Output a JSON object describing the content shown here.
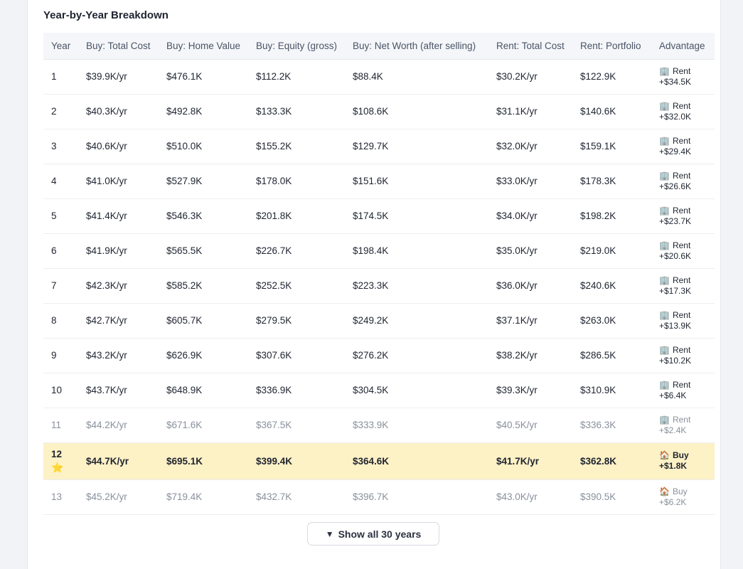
{
  "section": {
    "title": "Year-by-Year Breakdown"
  },
  "table": {
    "headers": [
      "Year",
      "Buy: Total Cost",
      "Buy: Home Value",
      "Buy: Equity (gross)",
      "Buy: Net Worth (after selling)",
      "Rent: Total Cost",
      "Rent: Portfolio",
      "Advantage"
    ],
    "rows": [
      {
        "year": "1",
        "total_cost": "$39.9K/yr",
        "home_value": "$476.1K",
        "equity": "$112.2K",
        "net_worth": "$88.4K",
        "rent_cost": "$30.2K/yr",
        "portfolio": "$122.9K",
        "adv_label": "Rent",
        "adv_amount": "+$34.5K",
        "adv_icon": "office-building-icon",
        "state": "normal"
      },
      {
        "year": "2",
        "total_cost": "$40.3K/yr",
        "home_value": "$492.8K",
        "equity": "$133.3K",
        "net_worth": "$108.6K",
        "rent_cost": "$31.1K/yr",
        "portfolio": "$140.6K",
        "adv_label": "Rent",
        "adv_amount": "+$32.0K",
        "adv_icon": "office-building-icon",
        "state": "normal"
      },
      {
        "year": "3",
        "total_cost": "$40.6K/yr",
        "home_value": "$510.0K",
        "equity": "$155.2K",
        "net_worth": "$129.7K",
        "rent_cost": "$32.0K/yr",
        "portfolio": "$159.1K",
        "adv_label": "Rent",
        "adv_amount": "+$29.4K",
        "adv_icon": "office-building-icon",
        "state": "normal"
      },
      {
        "year": "4",
        "total_cost": "$41.0K/yr",
        "home_value": "$527.9K",
        "equity": "$178.0K",
        "net_worth": "$151.6K",
        "rent_cost": "$33.0K/yr",
        "portfolio": "$178.3K",
        "adv_label": "Rent",
        "adv_amount": "+$26.6K",
        "adv_icon": "office-building-icon",
        "state": "normal"
      },
      {
        "year": "5",
        "total_cost": "$41.4K/yr",
        "home_value": "$546.3K",
        "equity": "$201.8K",
        "net_worth": "$174.5K",
        "rent_cost": "$34.0K/yr",
        "portfolio": "$198.2K",
        "adv_label": "Rent",
        "adv_amount": "+$23.7K",
        "adv_icon": "office-building-icon",
        "state": "normal"
      },
      {
        "year": "6",
        "total_cost": "$41.9K/yr",
        "home_value": "$565.5K",
        "equity": "$226.7K",
        "net_worth": "$198.4K",
        "rent_cost": "$35.0K/yr",
        "portfolio": "$219.0K",
        "adv_label": "Rent",
        "adv_amount": "+$20.6K",
        "adv_icon": "office-building-icon",
        "state": "normal"
      },
      {
        "year": "7",
        "total_cost": "$42.3K/yr",
        "home_value": "$585.2K",
        "equity": "$252.5K",
        "net_worth": "$223.3K",
        "rent_cost": "$36.0K/yr",
        "portfolio": "$240.6K",
        "adv_label": "Rent",
        "adv_amount": "+$17.3K",
        "adv_icon": "office-building-icon",
        "state": "normal"
      },
      {
        "year": "8",
        "total_cost": "$42.7K/yr",
        "home_value": "$605.7K",
        "equity": "$279.5K",
        "net_worth": "$249.2K",
        "rent_cost": "$37.1K/yr",
        "portfolio": "$263.0K",
        "adv_label": "Rent",
        "adv_amount": "+$13.9K",
        "adv_icon": "office-building-icon",
        "state": "normal"
      },
      {
        "year": "9",
        "total_cost": "$43.2K/yr",
        "home_value": "$626.9K",
        "equity": "$307.6K",
        "net_worth": "$276.2K",
        "rent_cost": "$38.2K/yr",
        "portfolio": "$286.5K",
        "adv_label": "Rent",
        "adv_amount": "+$10.2K",
        "adv_icon": "office-building-icon",
        "state": "normal"
      },
      {
        "year": "10",
        "total_cost": "$43.7K/yr",
        "home_value": "$648.9K",
        "equity": "$336.9K",
        "net_worth": "$304.5K",
        "rent_cost": "$39.3K/yr",
        "portfolio": "$310.9K",
        "adv_label": "Rent",
        "adv_amount": "+$6.4K",
        "adv_icon": "office-building-icon",
        "state": "normal"
      },
      {
        "year": "11",
        "total_cost": "$44.2K/yr",
        "home_value": "$671.6K",
        "equity": "$367.5K",
        "net_worth": "$333.9K",
        "rent_cost": "$40.5K/yr",
        "portfolio": "$336.3K",
        "adv_label": "Rent",
        "adv_amount": "+$2.4K",
        "adv_icon": "office-building-icon",
        "state": "faded"
      },
      {
        "year": "12",
        "total_cost": "$44.7K/yr",
        "home_value": "$695.1K",
        "equity": "$399.4K",
        "net_worth": "$364.6K",
        "rent_cost": "$41.7K/yr",
        "portfolio": "$362.8K",
        "adv_label": "Buy",
        "adv_amount": "+$1.8K",
        "adv_icon": "house-icon",
        "state": "highlight",
        "marker_icon": "star-icon"
      },
      {
        "year": "13",
        "total_cost": "$45.2K/yr",
        "home_value": "$719.4K",
        "equity": "$432.7K",
        "net_worth": "$396.7K",
        "rent_cost": "$43.0K/yr",
        "portfolio": "$390.5K",
        "adv_label": "Buy",
        "adv_amount": "+$6.2K",
        "adv_icon": "house-icon",
        "state": "faded"
      }
    ]
  },
  "show_all": {
    "label": "Show all 30 years",
    "icon": "triangle-down-icon"
  },
  "colors": {
    "highlight_row": "#fdf1c6",
    "header_bg": "#f4f6f9",
    "faded_text": "#8a909c"
  }
}
